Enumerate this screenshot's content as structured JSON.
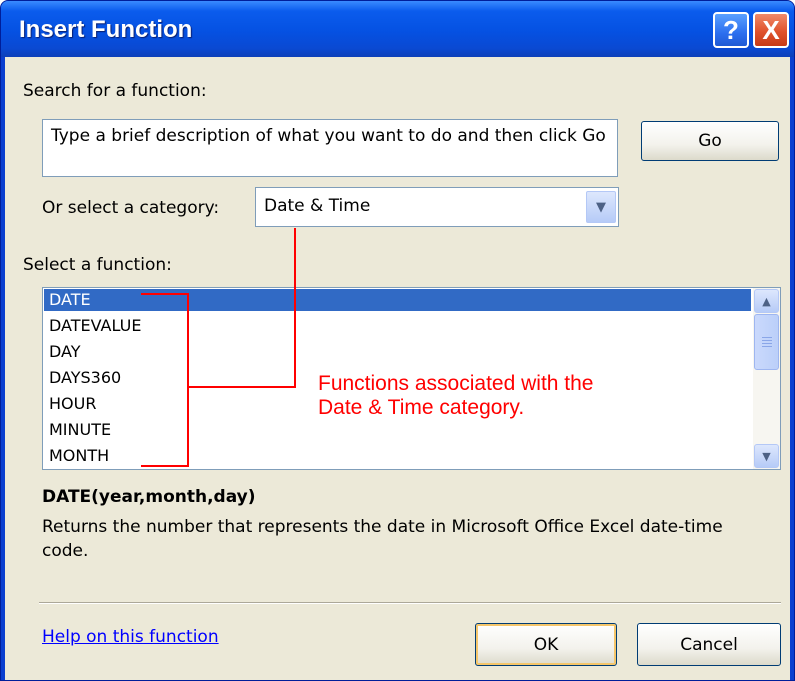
{
  "dialog": {
    "title": "Insert Function",
    "help_button": "?",
    "close_button": "X"
  },
  "search": {
    "label": "Search for a function:",
    "text": "Type a brief description of what you want to do and then click Go",
    "go_label": "Go"
  },
  "category": {
    "label": "Or select a category:",
    "selected": "Date & Time"
  },
  "functions": {
    "label": "Select a function:",
    "items": [
      "DATE",
      "DATEVALUE",
      "DAY",
      "DAYS360",
      "HOUR",
      "MINUTE",
      "MONTH"
    ],
    "selected_index": 0
  },
  "annotation": {
    "line1": "Functions associated with the",
    "line2": "Date & Time category.",
    "color": "#ff0000"
  },
  "details": {
    "signature": "DATE(year,month,day)",
    "description": "Returns the number that represents the date in Microsoft Office Excel date-time code."
  },
  "footer": {
    "help_link": "Help on this function",
    "ok_label": "OK",
    "cancel_label": "Cancel"
  },
  "colors": {
    "title_bar": "#0551e2",
    "selection": "#316ac5",
    "dialog_face": "#ece9d8",
    "link": "#0000ff"
  }
}
